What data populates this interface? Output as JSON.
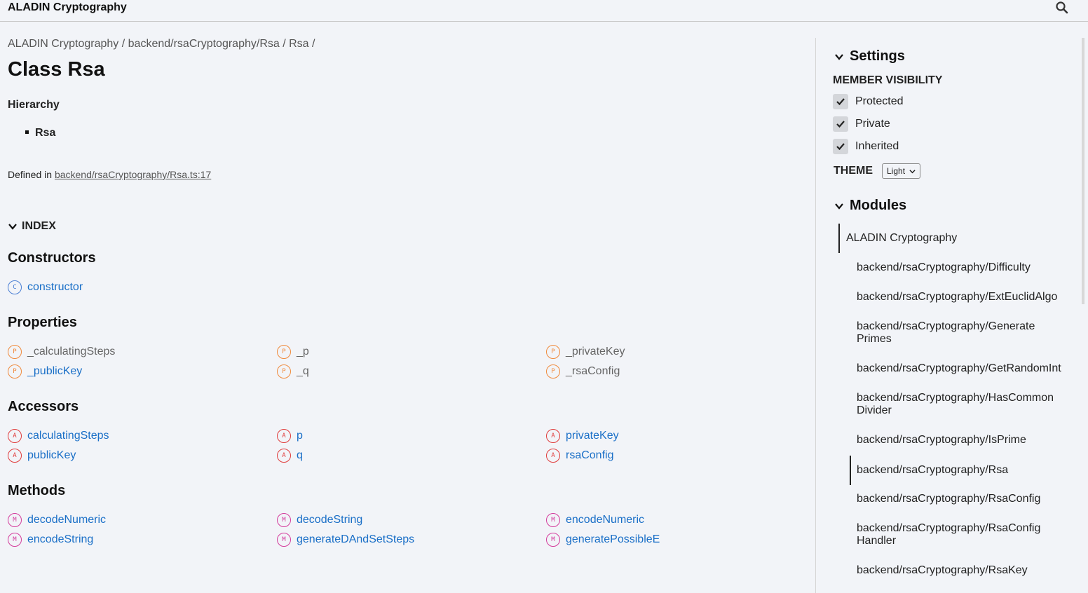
{
  "header": {
    "title": "ALADIN Cryptography"
  },
  "breadcrumb": [
    "ALADIN Cryptography",
    "backend/rsaCryptography/Rsa",
    "Rsa"
  ],
  "breadcrumb_sep": "/",
  "page": {
    "title": "Class Rsa"
  },
  "hierarchy": {
    "title": "Hierarchy",
    "item": "Rsa"
  },
  "defined": {
    "prefix": "Defined in ",
    "link": "backend/rsaCryptography/Rsa.ts:17"
  },
  "index": {
    "label": "INDEX"
  },
  "sections": {
    "constructors": {
      "title": "Constructors",
      "items": [
        {
          "badge": "C",
          "label": "constructor"
        }
      ]
    },
    "properties": {
      "title": "Properties",
      "items": [
        {
          "badge": "P",
          "label": "_calculatingSteps"
        },
        {
          "badge": "P",
          "label": "_p"
        },
        {
          "badge": "P",
          "label": "_privateKey"
        },
        {
          "badge": "P",
          "label": "_publicKey"
        },
        {
          "badge": "P",
          "label": "_q"
        },
        {
          "badge": "P",
          "label": "_rsaConfig"
        }
      ]
    },
    "accessors": {
      "title": "Accessors",
      "items": [
        {
          "badge": "A",
          "label": "calculatingSteps"
        },
        {
          "badge": "A",
          "label": "p"
        },
        {
          "badge": "A",
          "label": "privateKey"
        },
        {
          "badge": "A",
          "label": "publicKey"
        },
        {
          "badge": "A",
          "label": "q"
        },
        {
          "badge": "A",
          "label": "rsaConfig"
        }
      ]
    },
    "methods": {
      "title": "Methods",
      "items": [
        {
          "badge": "M",
          "label": "decodeNumeric"
        },
        {
          "badge": "M",
          "label": "decodeString"
        },
        {
          "badge": "M",
          "label": "encodeNumeric"
        },
        {
          "badge": "M",
          "label": "encodeString"
        },
        {
          "badge": "M",
          "label": "generateDAndSetSteps"
        },
        {
          "badge": "M",
          "label": "generatePossibleE"
        }
      ]
    }
  },
  "settings": {
    "title": "Settings",
    "member_visibility": "MEMBER VISIBILITY",
    "checkboxes": [
      "Protected",
      "Private",
      "Inherited"
    ],
    "theme_label": "THEME",
    "theme_value": "Light"
  },
  "modules": {
    "title": "Modules",
    "root": "ALADIN Cryptography",
    "items": [
      "backend/rsaCryptography/Difficulty",
      "backend/rsaCryptography/ExtEuclidAlgo",
      "backend/rsaCryptography/Generate Primes",
      "backend/rsaCryptography/GetRandomInt",
      "backend/rsaCryptography/HasCommon Divider",
      "backend/rsaCryptography/IsPrime",
      "backend/rsaCryptography/Rsa",
      "backend/rsaCryptography/RsaConfig",
      "backend/rsaCryptography/RsaConfig Handler",
      "backend/rsaCryptography/RsaKey"
    ]
  },
  "colors": {
    "link": "#1a6fc7",
    "constructor": "#4a7fd4",
    "property": "#f08a3c",
    "accessor": "#e03c3c",
    "method": "#d43c9c"
  },
  "icons": {
    "search": "search-icon",
    "check": "check-icon",
    "chevron": "chevron-down-icon"
  }
}
